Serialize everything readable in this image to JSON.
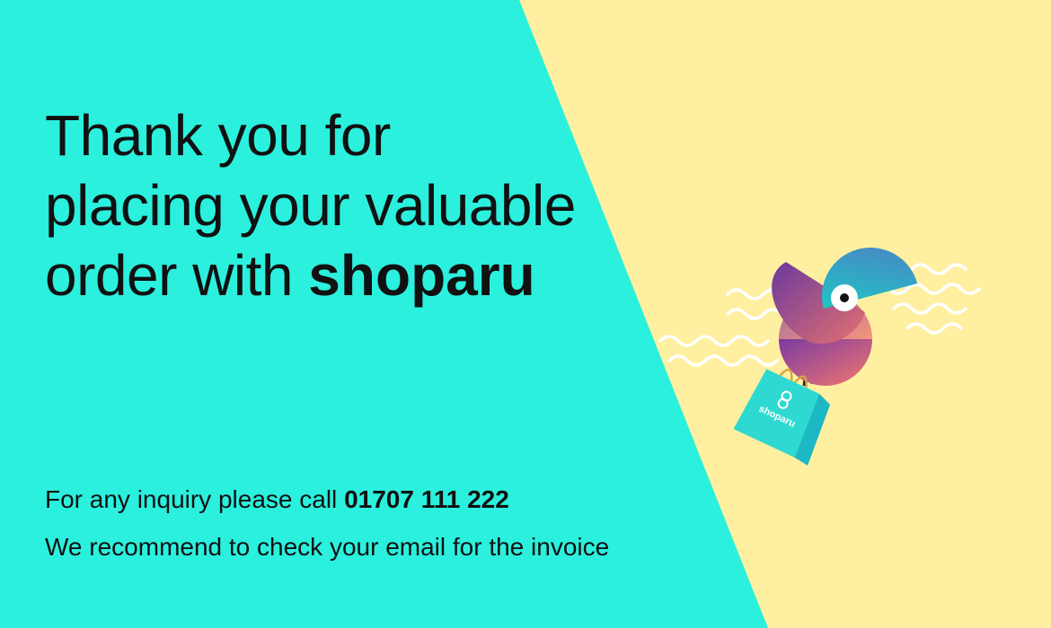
{
  "headline": {
    "line1": "Thank you for",
    "line2": "placing your valuable",
    "line3_prefix": "order with",
    "brand": "shoparu"
  },
  "inquiry": {
    "prefix": "For any inquiry please call",
    "phone": "01707 111 222"
  },
  "email_note": "We recommend to check your email for the invoice",
  "bag_logo_text": "shoparu",
  "colors": {
    "left_panel": "#2BF0DE",
    "right_panel": "#FEF0A0",
    "text": "#111111",
    "bag": "#2DD9D0",
    "bird_head": "#2FB4C8",
    "bird_body_pink": "#EE6E76",
    "bird_wing_purple": "#7B3BA0"
  },
  "icons": [
    "bird-mascot-illustration",
    "shopping-bag-icon",
    "wave-lines-decoration"
  ]
}
